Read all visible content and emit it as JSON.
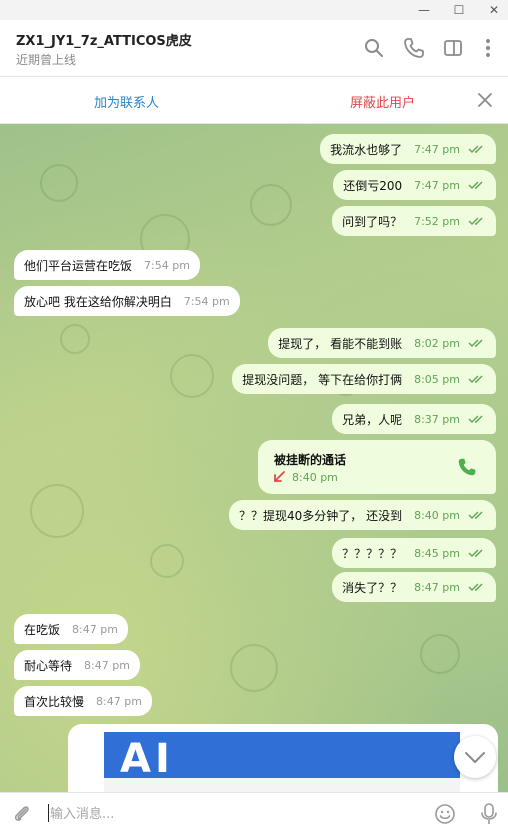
{
  "window": {
    "minimize_glyph": "—",
    "maximize_glyph": "☐",
    "close_glyph": "✕"
  },
  "header": {
    "title": "ZX1_JY1_7z_ATTICOS虎皮",
    "status": "近期曾上线",
    "icons": [
      "search-icon",
      "phone-icon",
      "sidebar-icon",
      "more-vertical-icon"
    ]
  },
  "actions": {
    "add_contact": "加为联系人",
    "block_user": "屏蔽此用户",
    "close_icon": "close-icon"
  },
  "messages": [
    {
      "dir": "out",
      "text": "我流水也够了",
      "time": "7:47 pm",
      "read": true
    },
    {
      "dir": "out",
      "text": "还倒亏200",
      "time": "7:47 pm",
      "read": true
    },
    {
      "dir": "out",
      "text": "问到了吗？",
      "time": "7:52 pm",
      "read": true
    },
    {
      "dir": "in",
      "text": "他们平台运营在吃饭",
      "time": "7:54 pm"
    },
    {
      "dir": "in",
      "text": "放心吧 我在这给你解决明白",
      "time": "7:54 pm"
    },
    {
      "dir": "out",
      "text": "提现了， 看能不能到账",
      "time": "8:02 pm",
      "read": true
    },
    {
      "dir": "out",
      "text": "提现没问题， 等下在给你打俩",
      "time": "8:05 pm",
      "read": true
    },
    {
      "dir": "out",
      "text": "兄弟，人呢",
      "time": "8:37 pm",
      "read": true
    },
    {
      "dir": "out",
      "text": "？？提现40多分钟了， 还没到",
      "time": "8:40 pm",
      "read": true
    },
    {
      "dir": "out",
      "text": "？？？？？",
      "time": "8:45 pm",
      "read": true
    },
    {
      "dir": "out",
      "text": "消失了？？",
      "time": "8:47 pm",
      "read": true
    },
    {
      "dir": "in",
      "text": "在吃饭",
      "time": "8:47 pm"
    },
    {
      "dir": "in",
      "text": "耐心等待",
      "time": "8:47 pm"
    },
    {
      "dir": "in",
      "text": "首次比较慢",
      "time": "8:47 pm"
    }
  ],
  "call": {
    "title": "被挂断的通话",
    "time": "8:40 pm",
    "status_icon": "missed-call-arrow-icon",
    "action_icon": "phone-icon"
  },
  "preview": {
    "image_text": "AI"
  },
  "input": {
    "placeholder": "输入消息..."
  },
  "colors": {
    "accent": "#2a84c7",
    "danger": "#e0474c",
    "outgoing_bubble": "#effdde",
    "incoming_bubble": "#ffffff",
    "tick": "#5fa455"
  }
}
